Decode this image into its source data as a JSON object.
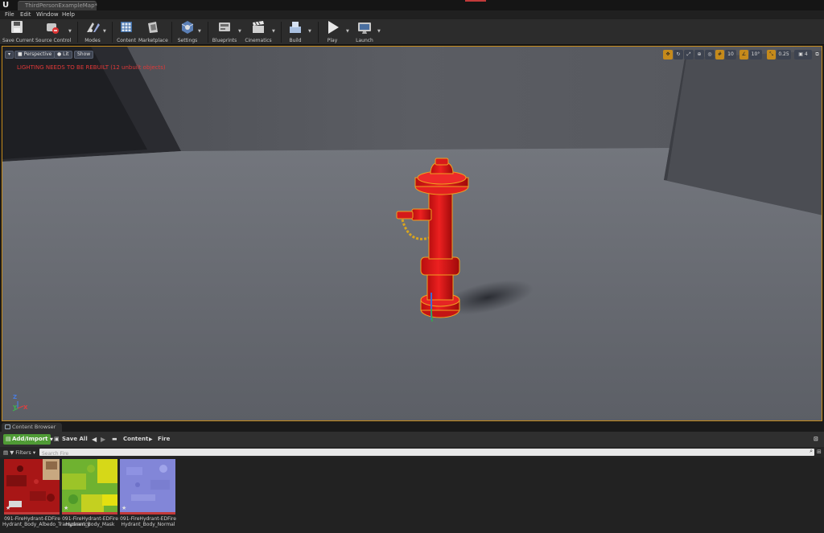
{
  "window": {
    "tab_title": "ThirdPersonExampleMap*"
  },
  "menu": [
    "File",
    "Edit",
    "Window",
    "Help"
  ],
  "toolbar": [
    {
      "label": "Save Current",
      "icon": "save-icon"
    },
    {
      "label": "Source Control",
      "icon": "source-control-icon"
    },
    {
      "label": "Modes",
      "icon": "modes-icon"
    },
    {
      "label": "Content",
      "icon": "content-icon"
    },
    {
      "label": "Marketplace",
      "icon": "marketplace-icon"
    },
    {
      "label": "Settings",
      "icon": "settings-icon"
    },
    {
      "label": "Blueprints",
      "icon": "blueprints-icon"
    },
    {
      "label": "Cinematics",
      "icon": "cinematics-icon"
    },
    {
      "label": "Build",
      "icon": "build-icon"
    },
    {
      "label": "Play",
      "icon": "play-icon"
    },
    {
      "label": "Launch",
      "icon": "launch-icon"
    }
  ],
  "viewport": {
    "perspective_label": "Perspective",
    "lit_label": "Lit",
    "show_label": "Show",
    "warning": "LIGHTING NEEDS TO BE REBUILT (12 unbuilt objects)",
    "grid_snap": "10",
    "rotation_snap": "10°",
    "scale_snap": "0.25",
    "camera_speed": "4",
    "axis_z": "Z",
    "axis_y": "Y",
    "axis_x": "X",
    "colors": {
      "selection": "#f0a020",
      "warning": "#e03838",
      "hydrant": "#e01818"
    }
  },
  "content_browser": {
    "tab_label": "Content Browser",
    "add_import_label": "Add/Import",
    "save_all_label": "Save All",
    "path": [
      "Content",
      "Fire"
    ],
    "filters_label": "Filters",
    "search_placeholder": "Search Fire",
    "assets": [
      {
        "name": "091-FireHydrant-EDFire Hydrant_Body_Albedo_Transparency",
        "type_color": "#c23a3a"
      },
      {
        "name": "091-FireHydrant-EDFire Hydrant_Body_Mask",
        "type_color": "#c23a3a"
      },
      {
        "name": "091-FireHydrant-EDFire Hydrant_Body_Normal",
        "type_color": "#c23a3a"
      }
    ]
  }
}
